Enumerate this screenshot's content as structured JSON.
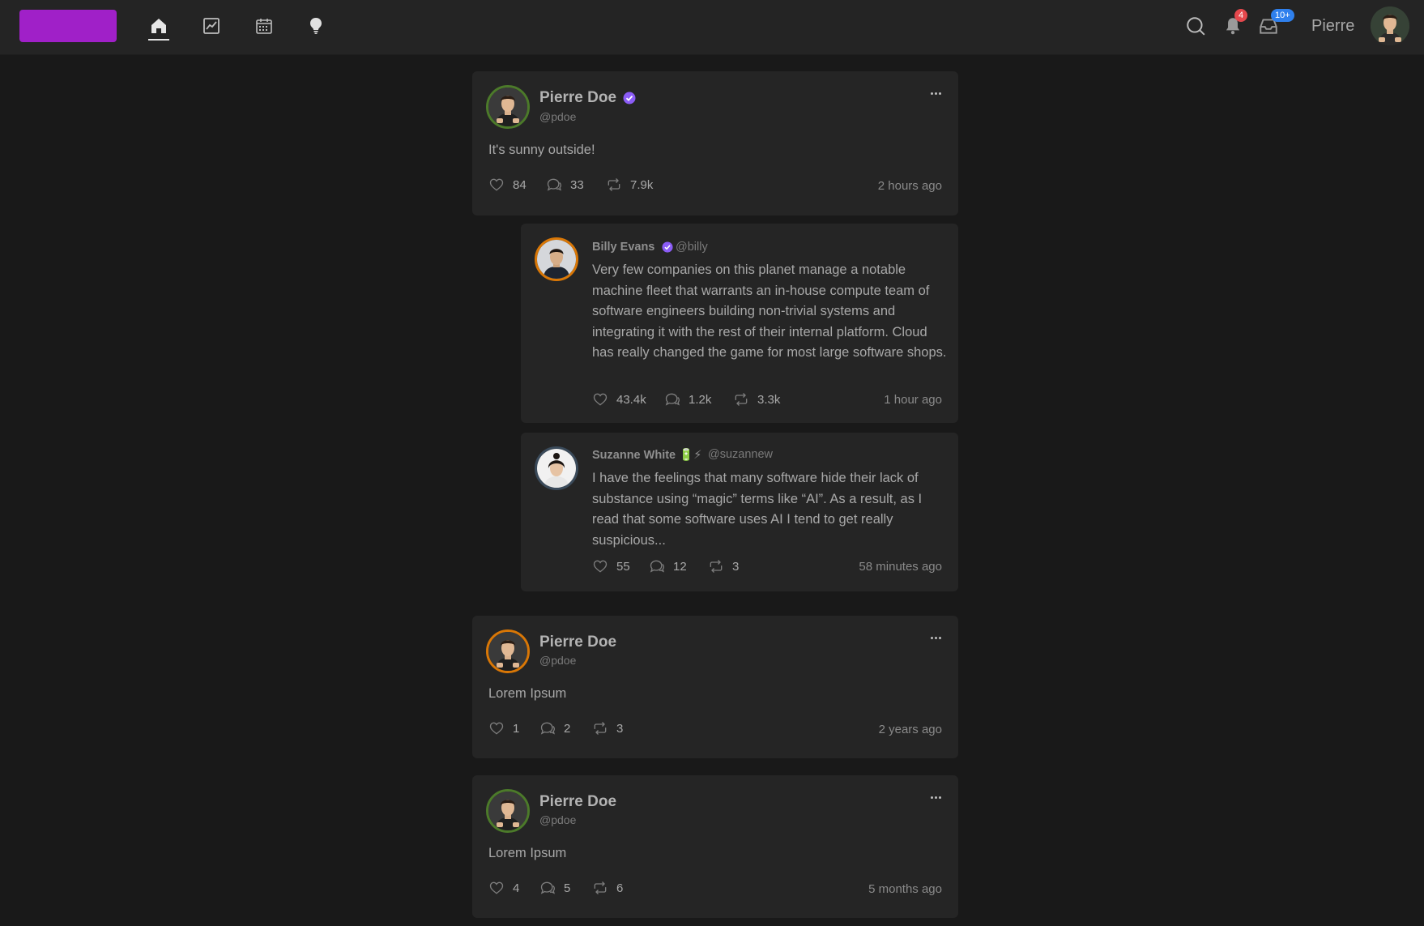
{
  "topbar": {
    "logo_color": "#a020c8",
    "nav": [
      {
        "name": "home-icon",
        "active": true
      },
      {
        "name": "trending-icon",
        "active": false
      },
      {
        "name": "calendar-icon",
        "active": false
      },
      {
        "name": "lightbulb-icon",
        "active": false
      }
    ],
    "notifications_badge": "4",
    "inbox_badge": "10+",
    "username": "Pierre"
  },
  "posts": [
    {
      "author": "Pierre Doe",
      "handle": "@pdoe",
      "verified": true,
      "text": "It's sunny outside!",
      "likes": "84",
      "comments": "33",
      "reposts": "7.9k",
      "time": "2 hours ago",
      "replies": [
        {
          "author": "Billy Evans",
          "handle": "@billy",
          "verified": true,
          "text": "Very few companies on this planet manage a notable machine fleet that warrants an in-house compute team of software engineers building non-trivial systems and integrating it with the rest of their internal platform. Cloud has really changed the game for most large software shops.",
          "likes": "43.4k",
          "comments": "1.2k",
          "reposts": "3.3k",
          "time": "1 hour ago"
        },
        {
          "author": "Suzanne White 🔋⚡",
          "handle": "@suzannew",
          "verified": false,
          "text": "I have the feelings that many software hide their lack of substance using “magic” terms like “AI”. As a result, as I read that some software uses AI I tend to get really suspicious...",
          "likes": "55",
          "comments": "12",
          "reposts": "3",
          "time": "58 minutes ago"
        }
      ]
    },
    {
      "author": "Pierre Doe",
      "handle": "@pdoe",
      "verified": false,
      "text": "Lorem Ipsum",
      "likes": "1",
      "comments": "2",
      "reposts": "3",
      "time": "2 years ago"
    },
    {
      "author": "Pierre Doe",
      "handle": "@pdoe",
      "verified": false,
      "text": "Lorem Ipsum",
      "likes": "4",
      "comments": "5",
      "reposts": "6",
      "time": "5 months ago"
    }
  ],
  "colors": {
    "verified": "#8b5cf6",
    "notif_badge": "#e5484d",
    "inbox_badge": "#2f80ed",
    "avatar_ring_green": "#4c7a2a",
    "avatar_ring_orange": "#d97706"
  }
}
